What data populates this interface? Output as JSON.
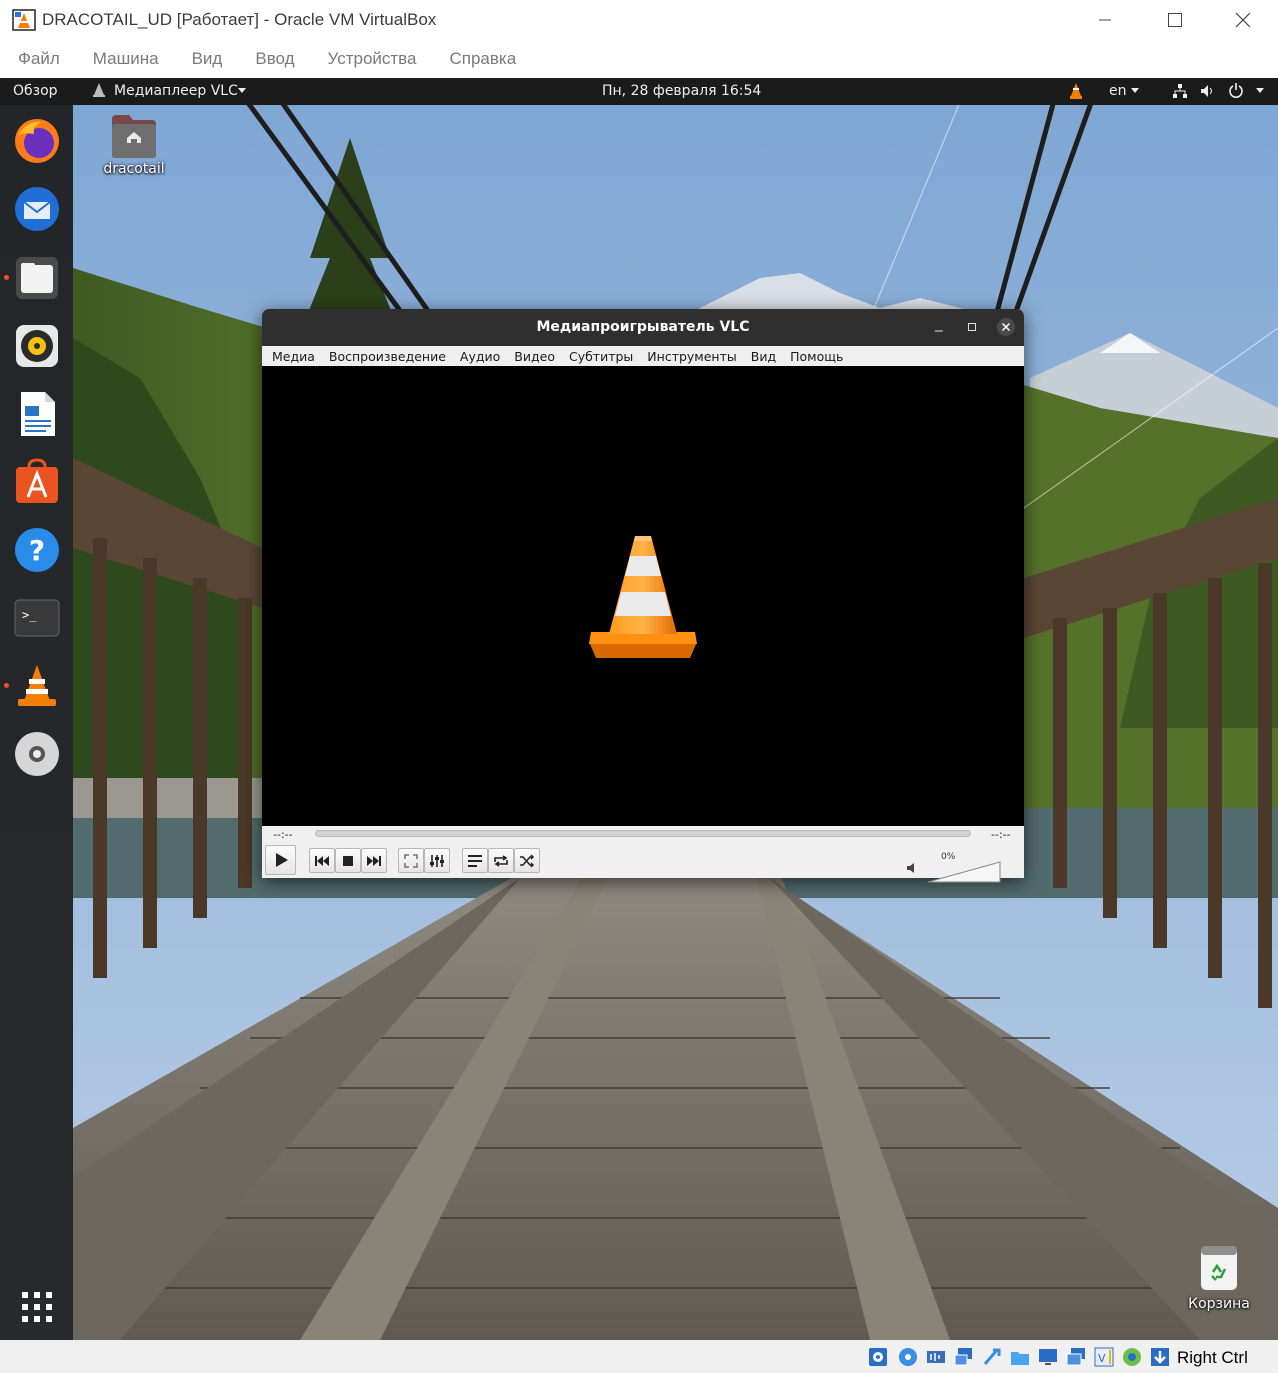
{
  "vbox": {
    "title": "DRACOTAIL_UD [Работает] - Oracle VM VirtualBox",
    "menu": [
      "Файл",
      "Машина",
      "Вид",
      "Ввод",
      "Устройства",
      "Справка"
    ],
    "host_key": "Right Ctrl"
  },
  "topbar": {
    "activities": "Обзор",
    "app_menu": "Медиаплеер VLC",
    "clock": "Пн, 28 февраля  16:54",
    "keyboard_layout": "en"
  },
  "dock": {
    "items": [
      {
        "name": "firefox-icon",
        "running": false
      },
      {
        "name": "thunderbird-icon",
        "running": false
      },
      {
        "name": "files-icon",
        "running": true
      },
      {
        "name": "rhythmbox-icon",
        "running": false
      },
      {
        "name": "libreoffice-writer-icon",
        "running": false
      },
      {
        "name": "ubuntu-software-icon",
        "running": false
      },
      {
        "name": "help-icon",
        "running": false
      },
      {
        "name": "terminal-icon",
        "running": false
      },
      {
        "name": "vlc-icon",
        "running": true
      },
      {
        "name": "disc-icon",
        "running": false
      }
    ]
  },
  "desktop": {
    "home_label": "dracotail",
    "trash_label": "Корзина"
  },
  "vlc": {
    "title": "Медиапроигрыватель VLC",
    "menu": [
      "Медиа",
      "Воспроизведение",
      "Аудио",
      "Видео",
      "Субтитры",
      "Инструменты",
      "Вид",
      "Помощь"
    ],
    "time_elapsed": "--:--",
    "time_total": "--:--",
    "volume": "0%"
  },
  "colors": {
    "ubuntu_orange": "#e95420",
    "vlc_orange": "#f57f06",
    "topbar": "#1b1b1b",
    "dock": "#1c1c1c"
  }
}
